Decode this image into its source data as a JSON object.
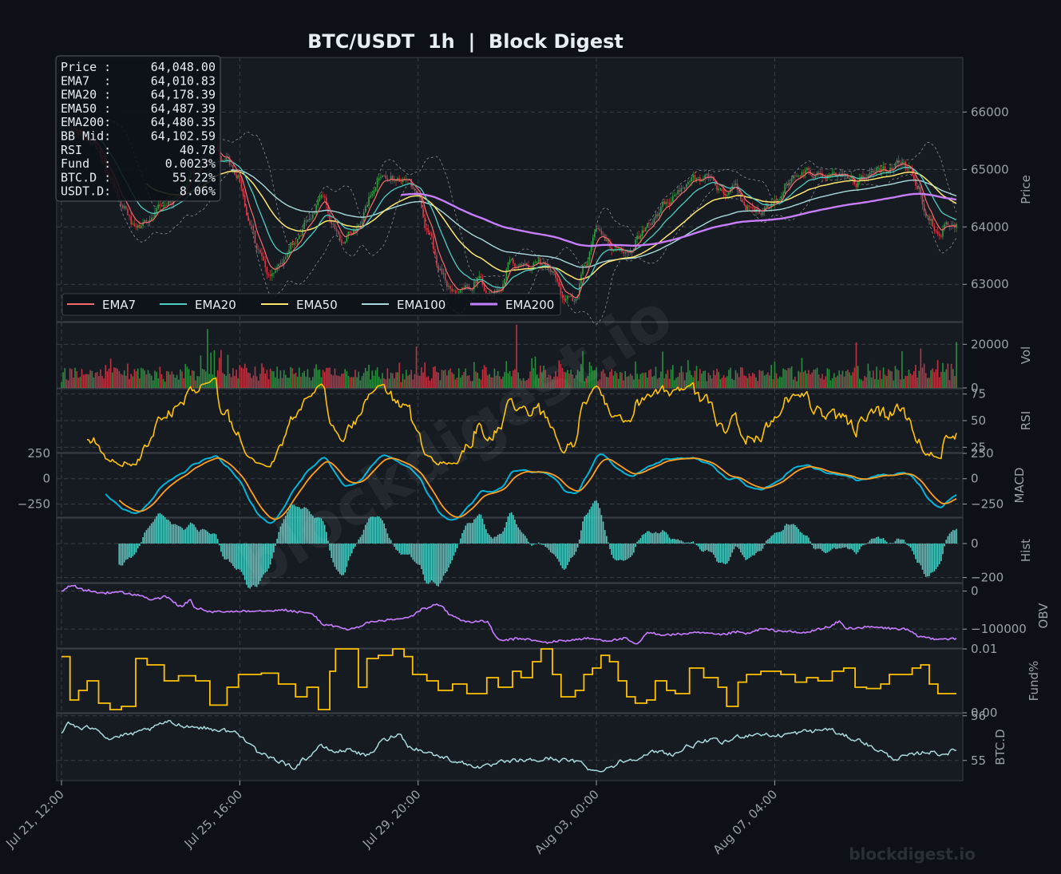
{
  "colors": {
    "background": "#0d1117",
    "panel": "#161b22",
    "grid": "#3a3f47",
    "up": "#2ea043",
    "down": "#d73a49",
    "text": "#e6edf3",
    "muted": "#9aa0a6",
    "ema7": "#f76b6b",
    "ema20": "#4ecdc4",
    "ema50": "#ffe66d",
    "ema100": "#a8dadc",
    "ema200": "#c77dff",
    "macd": "#00b4d8",
    "signal": "#ff9f1c",
    "hist": "#4ecdc4",
    "rsi": "#ffc300",
    "obv": "#c77dff",
    "fund": "#ffc300",
    "btcd": "#a8dadc"
  },
  "chart_data": {
    "type": "line",
    "title": "BTC/USDT  1h  |  Block Digest",
    "watermark": "blockdigest.io",
    "x_ticks": [
      "Jul 21, 12:00",
      "Jul 25, 16:00",
      "Jul 29, 20:00",
      "Aug 03, 00:00",
      "Aug 07, 04:00"
    ],
    "info_box": [
      {
        "label": "Price :",
        "value": "64,048.00"
      },
      {
        "label": "EMA7  :",
        "value": "64,010.83"
      },
      {
        "label": "EMA20 :",
        "value": "64,178.39"
      },
      {
        "label": "EMA50 :",
        "value": "64,487.39"
      },
      {
        "label": "EMA200:",
        "value": "64,480.35"
      },
      {
        "label": "BB Mid:",
        "value": "64,102.59"
      },
      {
        "label": "RSI   :",
        "value": "40.78"
      },
      {
        "label": "Fund  :",
        "value": "0.0023%"
      },
      {
        "label": "BTC.D :",
        "value": "55.22%"
      },
      {
        "label": "USDT.D:",
        "value": "8.06%"
      }
    ],
    "legend": [
      "EMA7",
      "EMA20",
      "EMA50",
      "EMA100",
      "EMA200"
    ],
    "price_anchors": [
      [
        0,
        65800
      ],
      [
        10,
        65650
      ],
      [
        20,
        65400
      ],
      [
        28,
        64900
      ],
      [
        36,
        64300
      ],
      [
        44,
        63950
      ],
      [
        52,
        64150
      ],
      [
        62,
        64400
      ],
      [
        70,
        64600
      ],
      [
        78,
        64900
      ],
      [
        84,
        65250
      ],
      [
        90,
        65400
      ],
      [
        97,
        65150
      ],
      [
        104,
        64800
      ],
      [
        110,
        64200
      ],
      [
        116,
        63550
      ],
      [
        122,
        63150
      ],
      [
        130,
        63400
      ],
      [
        138,
        63750
      ],
      [
        146,
        64200
      ],
      [
        154,
        64500
      ],
      [
        160,
        64050
      ],
      [
        166,
        63800
      ],
      [
        174,
        63950
      ],
      [
        182,
        64500
      ],
      [
        188,
        64900
      ],
      [
        196,
        64850
      ],
      [
        204,
        64750
      ],
      [
        210,
        64500
      ],
      [
        216,
        63900
      ],
      [
        222,
        63300
      ],
      [
        230,
        62900
      ],
      [
        238,
        62950
      ],
      [
        246,
        63100
      ],
      [
        252,
        62850
      ],
      [
        258,
        62950
      ],
      [
        264,
        63350
      ],
      [
        272,
        63250
      ],
      [
        280,
        63450
      ],
      [
        288,
        63200
      ],
      [
        296,
        62800
      ],
      [
        302,
        62700
      ],
      [
        308,
        63300
      ],
      [
        316,
        63900
      ],
      [
        324,
        63700
      ],
      [
        332,
        63500
      ],
      [
        340,
        63850
      ],
      [
        348,
        64100
      ],
      [
        356,
        64400
      ],
      [
        364,
        64600
      ],
      [
        372,
        64800
      ],
      [
        380,
        64850
      ],
      [
        388,
        64600
      ],
      [
        396,
        64650
      ],
      [
        404,
        64350
      ],
      [
        412,
        64250
      ],
      [
        420,
        64400
      ],
      [
        428,
        64800
      ],
      [
        436,
        64900
      ],
      [
        444,
        64950
      ],
      [
        452,
        64850
      ],
      [
        460,
        64950
      ],
      [
        468,
        64800
      ],
      [
        476,
        64900
      ],
      [
        484,
        64950
      ],
      [
        492,
        65100
      ],
      [
        498,
        65050
      ],
      [
        504,
        64700
      ],
      [
        510,
        64150
      ],
      [
        516,
        63950
      ],
      [
        522,
        64000
      ],
      [
        527,
        64048
      ]
    ],
    "price_ylim": [
      62350,
      66950
    ],
    "price_ticks": [
      63000,
      64000,
      65000,
      66000
    ],
    "ema200_start": 200,
    "vol_ticks": [
      0,
      20000
    ],
    "vol_ylim": [
      0,
      30000
    ],
    "rsi_ticks": [
      25,
      50,
      75
    ],
    "rsi_ylim": [
      20,
      80
    ],
    "rsi_start": 14,
    "macd_ticks": [
      -250,
      0,
      250
    ],
    "macd_ylim": [
      -380,
      250
    ],
    "macd_start": 26,
    "hist_ticks": [
      -200,
      0
    ],
    "hist_ylim": [
      -230,
      150
    ],
    "hist_start": 34,
    "obv_ticks": [
      -100000,
      0
    ],
    "obv_ylim": [
      -150000,
      20000
    ],
    "obv_anchors": [
      [
        0,
        0
      ],
      [
        6,
        15000
      ],
      [
        14,
        2000
      ],
      [
        24,
        -5000
      ],
      [
        34,
        -3000
      ],
      [
        44,
        -10000
      ],
      [
        54,
        -22000
      ],
      [
        62,
        -15000
      ],
      [
        70,
        -40000
      ],
      [
        76,
        -25000
      ],
      [
        78,
        -45000
      ],
      [
        90,
        -55000
      ],
      [
        110,
        -52000
      ],
      [
        130,
        -50000
      ],
      [
        146,
        -58000
      ],
      [
        156,
        -90000
      ],
      [
        170,
        -100000
      ],
      [
        184,
        -80000
      ],
      [
        196,
        -75000
      ],
      [
        204,
        -70000
      ],
      [
        214,
        -45000
      ],
      [
        222,
        -35000
      ],
      [
        230,
        -65000
      ],
      [
        238,
        -80000
      ],
      [
        250,
        -80000
      ],
      [
        258,
        -130000
      ],
      [
        270,
        -125000
      ],
      [
        286,
        -135000
      ],
      [
        296,
        -130000
      ],
      [
        310,
        -125000
      ],
      [
        322,
        -130000
      ],
      [
        332,
        -125000
      ],
      [
        338,
        -140000
      ],
      [
        346,
        -110000
      ],
      [
        356,
        -115000
      ],
      [
        376,
        -110000
      ],
      [
        388,
        -115000
      ],
      [
        398,
        -108000
      ],
      [
        404,
        -112000
      ],
      [
        412,
        -100000
      ],
      [
        424,
        -105000
      ],
      [
        436,
        -110000
      ],
      [
        452,
        -95000
      ],
      [
        458,
        -80000
      ],
      [
        462,
        -98000
      ],
      [
        476,
        -95000
      ],
      [
        496,
        -100000
      ],
      [
        506,
        -120000
      ],
      [
        514,
        -125000
      ],
      [
        527,
        -126000
      ]
    ],
    "fund_ticks": [
      0.0,
      0.01
    ],
    "fund_tick_labels": [
      "0.00",
      "0.01"
    ],
    "fund_ylim": [
      0.0,
      0.01
    ],
    "fund_steps": [
      [
        0,
        0.0088
      ],
      [
        6,
        0.002
      ],
      [
        12,
        0.0035
      ],
      [
        18,
        0.005
      ],
      [
        26,
        0.0015
      ],
      [
        34,
        0.0005
      ],
      [
        42,
        0.001
      ],
      [
        52,
        0.0085
      ],
      [
        60,
        0.0075
      ],
      [
        72,
        0.005
      ],
      [
        82,
        0.0058
      ],
      [
        94,
        0.005
      ],
      [
        104,
        0.0012
      ],
      [
        116,
        0.004
      ],
      [
        124,
        0.006
      ],
      [
        140,
        0.0062
      ],
      [
        152,
        0.0045
      ],
      [
        164,
        0.0025
      ],
      [
        172,
        0.004
      ],
      [
        180,
        0.0005
      ],
      [
        188,
        0.0065
      ],
      [
        192,
        0.01
      ],
      [
        208,
        0.004
      ],
      [
        214,
        0.0085
      ],
      [
        222,
        0.009
      ],
      [
        232,
        0.01
      ],
      [
        240,
        0.0088
      ],
      [
        246,
        0.006
      ],
      [
        256,
        0.005
      ],
      [
        264,
        0.0035
      ],
      [
        274,
        0.0045
      ],
      [
        284,
        0.003
      ],
      [
        298,
        0.0055
      ],
      [
        306,
        0.004
      ],
      [
        316,
        0.0065
      ],
      [
        322,
        0.0055
      ],
      [
        330,
        0.008
      ],
      [
        336,
        0.01
      ],
      [
        344,
        0.006
      ],
      [
        350,
        0.0025
      ],
      [
        360,
        0.0035
      ],
      [
        366,
        0.006
      ],
      [
        372,
        0.007
      ],
      [
        378,
        0.009
      ],
      [
        384,
        0.008
      ],
      [
        390,
        0.005
      ],
      [
        396,
        0.0025
      ],
      [
        402,
        0.0015
      ],
      [
        410,
        0.002
      ],
      [
        416,
        0.005
      ],
      [
        424,
        0.0035
      ],
      [
        430,
        0.003
      ],
      [
        440,
        0.007
      ],
      [
        450,
        0.0055
      ],
      [
        460,
        0.004
      ],
      [
        466,
        0.001
      ],
      [
        474,
        0.0048
      ],
      [
        480,
        0.006
      ],
      [
        490,
        0.0065
      ],
      [
        504,
        0.006
      ],
      [
        514,
        0.0048
      ],
      [
        522,
        0.0055
      ],
      [
        530,
        0.005
      ],
      [
        540,
        0.0065
      ],
      [
        548,
        0.007
      ],
      [
        556,
        0.004
      ],
      [
        564,
        0.0038
      ],
      [
        574,
        0.0045
      ],
      [
        580,
        0.006
      ],
      [
        596,
        0.007
      ],
      [
        602,
        0.0075
      ],
      [
        608,
        0.0045
      ],
      [
        614,
        0.003
      ],
      [
        627,
        0.003
      ]
    ],
    "btcd_ticks": [
      55,
      56
    ],
    "btcd_ylim": [
      54.55,
      56.05
    ],
    "btcd_anchors": [
      [
        0,
        55.6
      ],
      [
        4,
        55.85
      ],
      [
        12,
        55.7
      ],
      [
        20,
        55.75
      ],
      [
        28,
        55.5
      ],
      [
        36,
        55.55
      ],
      [
        44,
        55.6
      ],
      [
        52,
        55.7
      ],
      [
        62,
        55.85
      ],
      [
        70,
        55.8
      ],
      [
        80,
        55.75
      ],
      [
        90,
        55.7
      ],
      [
        100,
        55.65
      ],
      [
        110,
        55.45
      ],
      [
        118,
        55.1
      ],
      [
        128,
        55.0
      ],
      [
        136,
        54.85
      ],
      [
        144,
        55.05
      ],
      [
        152,
        55.3
      ],
      [
        162,
        55.2
      ],
      [
        170,
        55.25
      ],
      [
        180,
        55.1
      ],
      [
        190,
        55.45
      ],
      [
        198,
        55.6
      ],
      [
        206,
        55.3
      ],
      [
        214,
        55.2
      ],
      [
        222,
        55.1
      ],
      [
        232,
        55.0
      ],
      [
        240,
        54.9
      ],
      [
        250,
        54.85
      ],
      [
        260,
        54.95
      ],
      [
        270,
        55.0
      ],
      [
        280,
        55.0
      ],
      [
        288,
        55.05
      ],
      [
        296,
        55.0
      ],
      [
        306,
        54.95
      ],
      [
        314,
        54.75
      ],
      [
        322,
        54.85
      ],
      [
        332,
        55.0
      ],
      [
        342,
        55.1
      ],
      [
        352,
        55.2
      ],
      [
        360,
        55.15
      ],
      [
        372,
        55.35
      ],
      [
        382,
        55.45
      ],
      [
        390,
        55.4
      ],
      [
        400,
        55.55
      ],
      [
        410,
        55.6
      ],
      [
        420,
        55.55
      ],
      [
        430,
        55.6
      ],
      [
        440,
        55.65
      ],
      [
        452,
        55.7
      ],
      [
        460,
        55.55
      ],
      [
        470,
        55.45
      ],
      [
        480,
        55.25
      ],
      [
        490,
        55.05
      ],
      [
        500,
        55.1
      ],
      [
        510,
        55.2
      ],
      [
        518,
        55.15
      ],
      [
        527,
        55.22
      ]
    ],
    "bars": 528,
    "tick_bar_indices": [
      0,
      105,
      210,
      315,
      420
    ]
  }
}
